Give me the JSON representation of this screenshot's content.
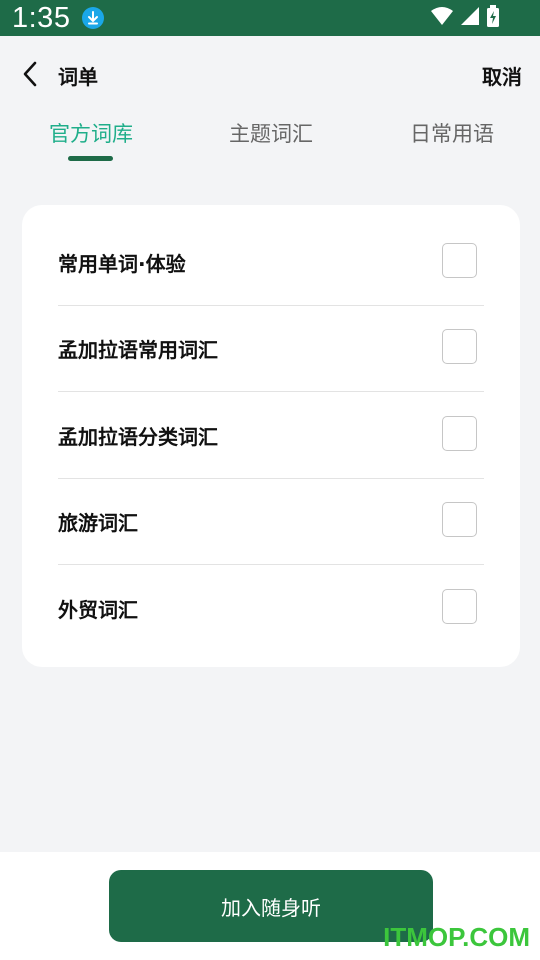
{
  "status_bar": {
    "time": "1:35"
  },
  "header": {
    "title": "词单",
    "cancel_label": "取消"
  },
  "tabs": [
    {
      "label": "官方词库",
      "active": true
    },
    {
      "label": "主题词汇",
      "active": false
    },
    {
      "label": "日常用语",
      "active": false
    }
  ],
  "list": {
    "items": [
      {
        "label": "常用单词·体验",
        "checked": false
      },
      {
        "label": "孟加拉语常用词汇",
        "checked": false
      },
      {
        "label": "孟加拉语分类词汇",
        "checked": false
      },
      {
        "label": "旅游词汇",
        "checked": false
      },
      {
        "label": "外贸词汇",
        "checked": false
      }
    ]
  },
  "action": {
    "button_label": "加入随身听"
  },
  "watermark": {
    "text": "ITMOP.COM"
  },
  "colors": {
    "primary": "#1e6b48",
    "tab_active": "#1fae8a",
    "background": "#f3f4f6",
    "download_badge": "#1aa7e8",
    "watermark": "#3cc63c"
  }
}
